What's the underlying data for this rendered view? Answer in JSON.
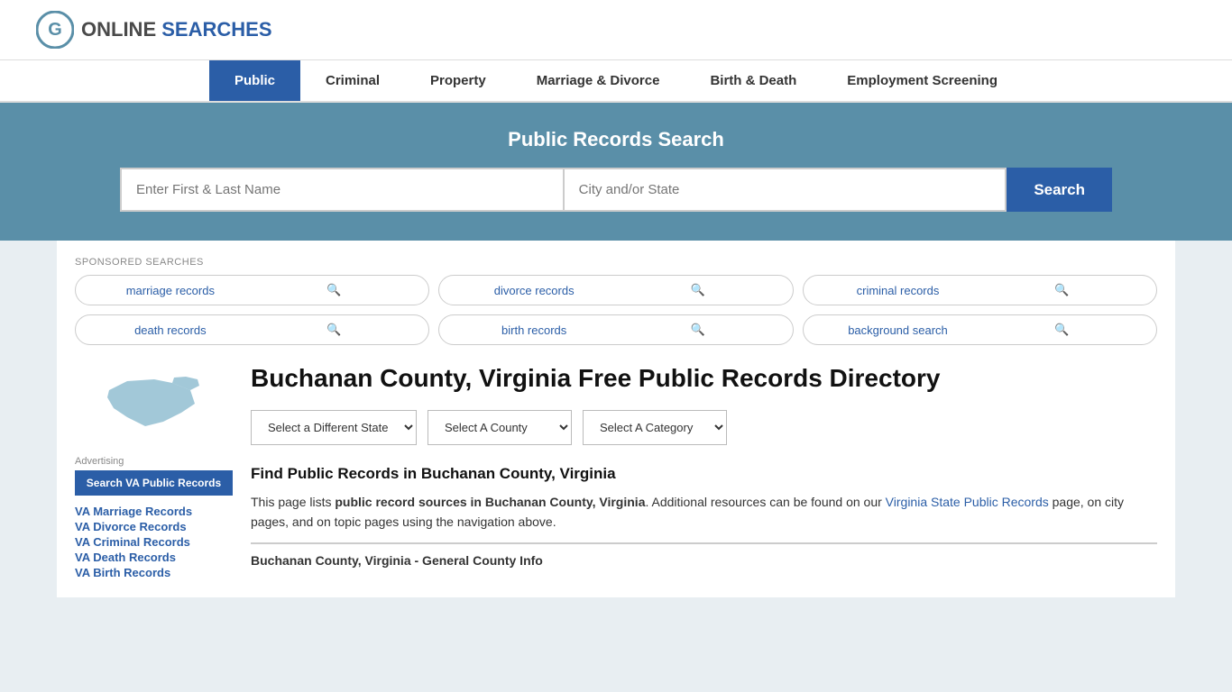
{
  "logo": {
    "text_online": "ONLINE",
    "text_searches": "SEARCHES"
  },
  "nav": {
    "items": [
      {
        "label": "Public",
        "active": true
      },
      {
        "label": "Criminal",
        "active": false
      },
      {
        "label": "Property",
        "active": false
      },
      {
        "label": "Marriage & Divorce",
        "active": false
      },
      {
        "label": "Birth & Death",
        "active": false
      },
      {
        "label": "Employment Screening",
        "active": false
      }
    ]
  },
  "hero": {
    "title": "Public Records Search",
    "name_placeholder": "Enter First & Last Name",
    "location_placeholder": "City and/or State",
    "search_button": "Search"
  },
  "sponsored": {
    "label": "SPONSORED SEARCHES",
    "pills": [
      {
        "text": "marriage records"
      },
      {
        "text": "divorce records"
      },
      {
        "text": "criminal records"
      },
      {
        "text": "death records"
      },
      {
        "text": "birth records"
      },
      {
        "text": "background search"
      }
    ]
  },
  "sidebar": {
    "advertising_label": "Advertising",
    "ad_button": "Search VA Public Records",
    "links": [
      {
        "text": "VA Marriage Records"
      },
      {
        "text": "VA Divorce Records"
      },
      {
        "text": "VA Criminal Records"
      },
      {
        "text": "VA Death Records"
      },
      {
        "text": "VA Birth Records"
      }
    ]
  },
  "main": {
    "page_title": "Buchanan County, Virginia Free Public Records Directory",
    "dropdowns": {
      "state": "Select a Different State",
      "county": "Select A County",
      "category": "Select A Category"
    },
    "find_title": "Find Public Records in Buchanan County, Virginia",
    "find_desc_1": "This page lists ",
    "find_desc_bold": "public record sources in Buchanan County, Virginia",
    "find_desc_2": ". Additional resources can be found on our ",
    "find_link_text": "Virginia State Public Records",
    "find_desc_3": " page, on city pages, and on topic pages using the navigation above.",
    "county_section_title": "Buchanan County, Virginia - General County Info"
  }
}
